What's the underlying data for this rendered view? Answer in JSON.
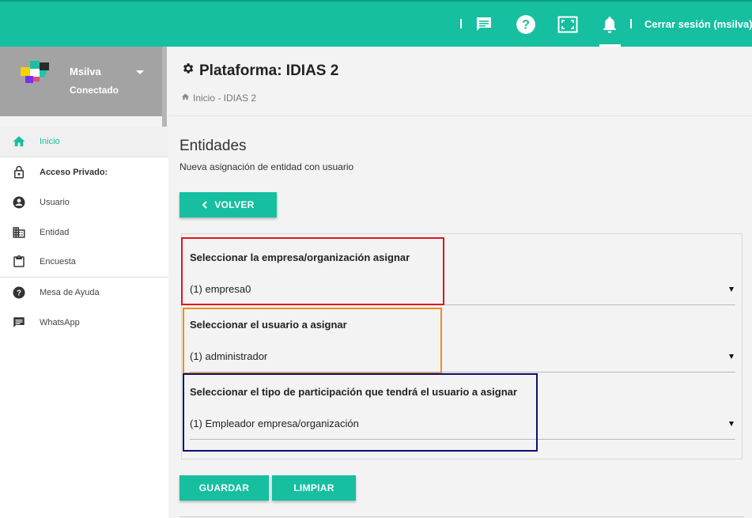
{
  "topbar": {
    "logout_label": "Cerrar sesión (msilva)",
    "icons": [
      "chat-icon",
      "help-icon",
      "fullscreen-icon",
      "bell-icon"
    ]
  },
  "profile": {
    "name": "Msilva",
    "status": "Conectado"
  },
  "sidebar": {
    "items": [
      {
        "label": "Inicio",
        "icon": "home-icon"
      },
      {
        "label": "Acceso Privado:",
        "icon": "lock-icon"
      },
      {
        "label": "Usuario",
        "icon": "user-icon"
      },
      {
        "label": "Entidad",
        "icon": "building-icon"
      },
      {
        "label": "Encuesta",
        "icon": "clipboard-icon"
      },
      {
        "label": "Mesa de Ayuda",
        "icon": "help-icon"
      },
      {
        "label": "WhatsApp",
        "icon": "message-icon"
      }
    ]
  },
  "header": {
    "title": "Plataforma: IDIAS 2",
    "breadcrumb": "Inicio - IDIAS 2"
  },
  "main": {
    "section_title": "Entidades",
    "section_subtitle": "Nueva asignación de entidad con usuario",
    "back_label": "VOLVER",
    "fields": [
      {
        "label": "Seleccionar la empresa/organización asignar",
        "value": "(1) empresa0"
      },
      {
        "label": "Seleccionar el usuario a asignar",
        "value": "(1) administrador"
      },
      {
        "label": "Seleccionar el tipo de participación que tendrá el usuario a asignar",
        "value": "(1) Empleador empresa/organización"
      }
    ],
    "save_label": "GUARDAR",
    "clear_label": "LIMPIAR"
  },
  "colors": {
    "accent": "#16bfa0",
    "highlight_1": "#e0151c",
    "highlight_2": "#f08c1c",
    "highlight_3": "#0e0e6e"
  }
}
